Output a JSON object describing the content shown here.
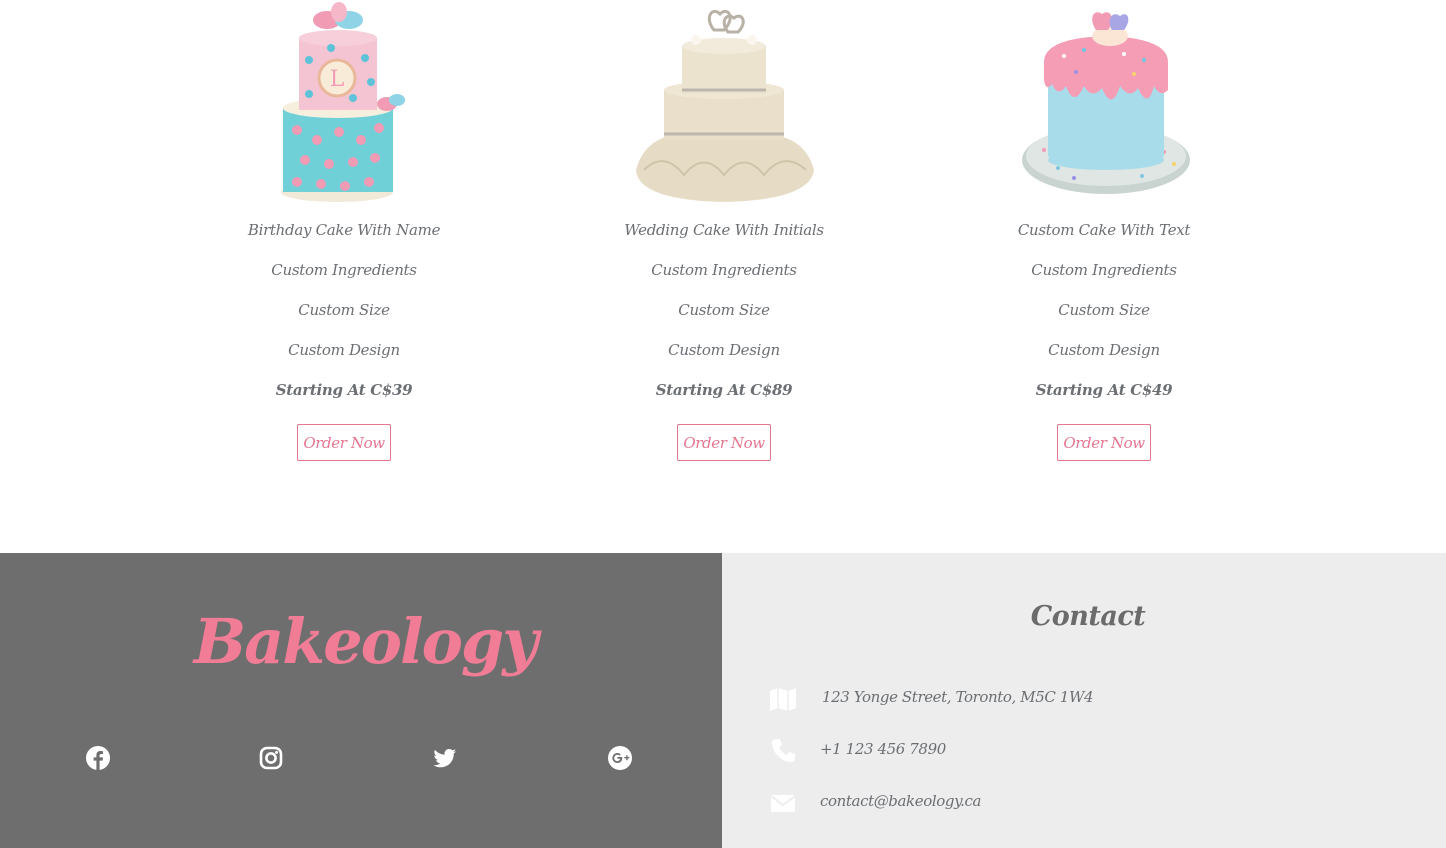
{
  "products": [
    {
      "image": "birthday-cake-image",
      "name": "Birthday Cake With Name",
      "ingredients": "Custom Ingredients",
      "size": "Custom Size",
      "design": "Custom Design",
      "price": "Starting At C$39",
      "button": "Order Now"
    },
    {
      "image": "wedding-cake-image",
      "name": "Wedding Cake With Initials",
      "ingredients": "Custom Ingredients",
      "size": "Custom Size",
      "design": "Custom Design",
      "price": "Starting At C$89",
      "button": "Order Now"
    },
    {
      "image": "custom-cake-image",
      "name": "Custom Cake With Text",
      "ingredients": "Custom Ingredients",
      "size": "Custom Size",
      "design": "Custom Design",
      "price": "Starting At C$49",
      "button": "Order Now"
    }
  ],
  "footer": {
    "brand": "Bakeology",
    "social": [
      "facebook-icon",
      "instagram-icon",
      "twitter-icon",
      "google-plus-icon"
    ],
    "contact_title": "Contact",
    "address": "123 Yonge Street, Toronto, M5C 1W4",
    "phone": "+1 123 456 7890",
    "email": "contact@bakeology.ca"
  },
  "colors": {
    "accent": "#f07c96",
    "text": "#6b6f73",
    "footer_dark": "#6e6e6e",
    "footer_light": "#ededed"
  }
}
